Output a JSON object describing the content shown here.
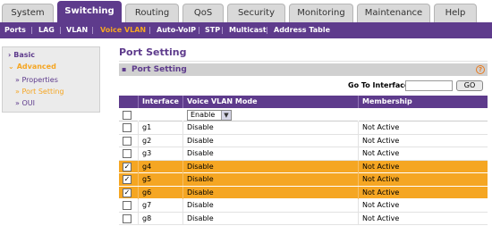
{
  "top_tabs": [
    "System",
    "Switching",
    "Routing",
    "QoS",
    "Security",
    "Monitoring",
    "Maintenance",
    "Help"
  ],
  "active_tab": "Switching",
  "sub_nav": [
    "Ports",
    "LAG",
    "VLAN",
    "Voice VLAN",
    "Auto-VoIP",
    "STP",
    "Multicast",
    "Address Table"
  ],
  "active_sub": "Voice VLAN",
  "sidebar": {
    "basic": "Basic",
    "advanced": "Advanced",
    "items": [
      "Properties",
      "Port Setting",
      "OUI"
    ],
    "active_item": "Port Setting"
  },
  "page_title": "Port Setting",
  "panel_title": "Port Setting",
  "help_icon_glyph": "?",
  "goto": {
    "label": "Go To Interface",
    "value": "",
    "button": "GO"
  },
  "table": {
    "headers": [
      "",
      "Interface",
      "Voice VLAN Mode",
      "Membership"
    ],
    "edit_row": {
      "mode_value": "Enable"
    },
    "rows": [
      {
        "interface": "g1",
        "mode": "Disable",
        "membership": "Not Active",
        "checked": false
      },
      {
        "interface": "g2",
        "mode": "Disable",
        "membership": "Not Active",
        "checked": false
      },
      {
        "interface": "g3",
        "mode": "Disable",
        "membership": "Not Active",
        "checked": false
      },
      {
        "interface": "g4",
        "mode": "Disable",
        "membership": "Not Active",
        "checked": true
      },
      {
        "interface": "g5",
        "mode": "Disable",
        "membership": "Not Active",
        "checked": true
      },
      {
        "interface": "g6",
        "mode": "Disable",
        "membership": "Not Active",
        "checked": true
      },
      {
        "interface": "g7",
        "mode": "Disable",
        "membership": "Not Active",
        "checked": false
      },
      {
        "interface": "g8",
        "mode": "Disable",
        "membership": "Not Active",
        "checked": false
      }
    ]
  },
  "colors": {
    "brand_purple": "#5e3b8c",
    "accent_orange": "#f5a623"
  }
}
